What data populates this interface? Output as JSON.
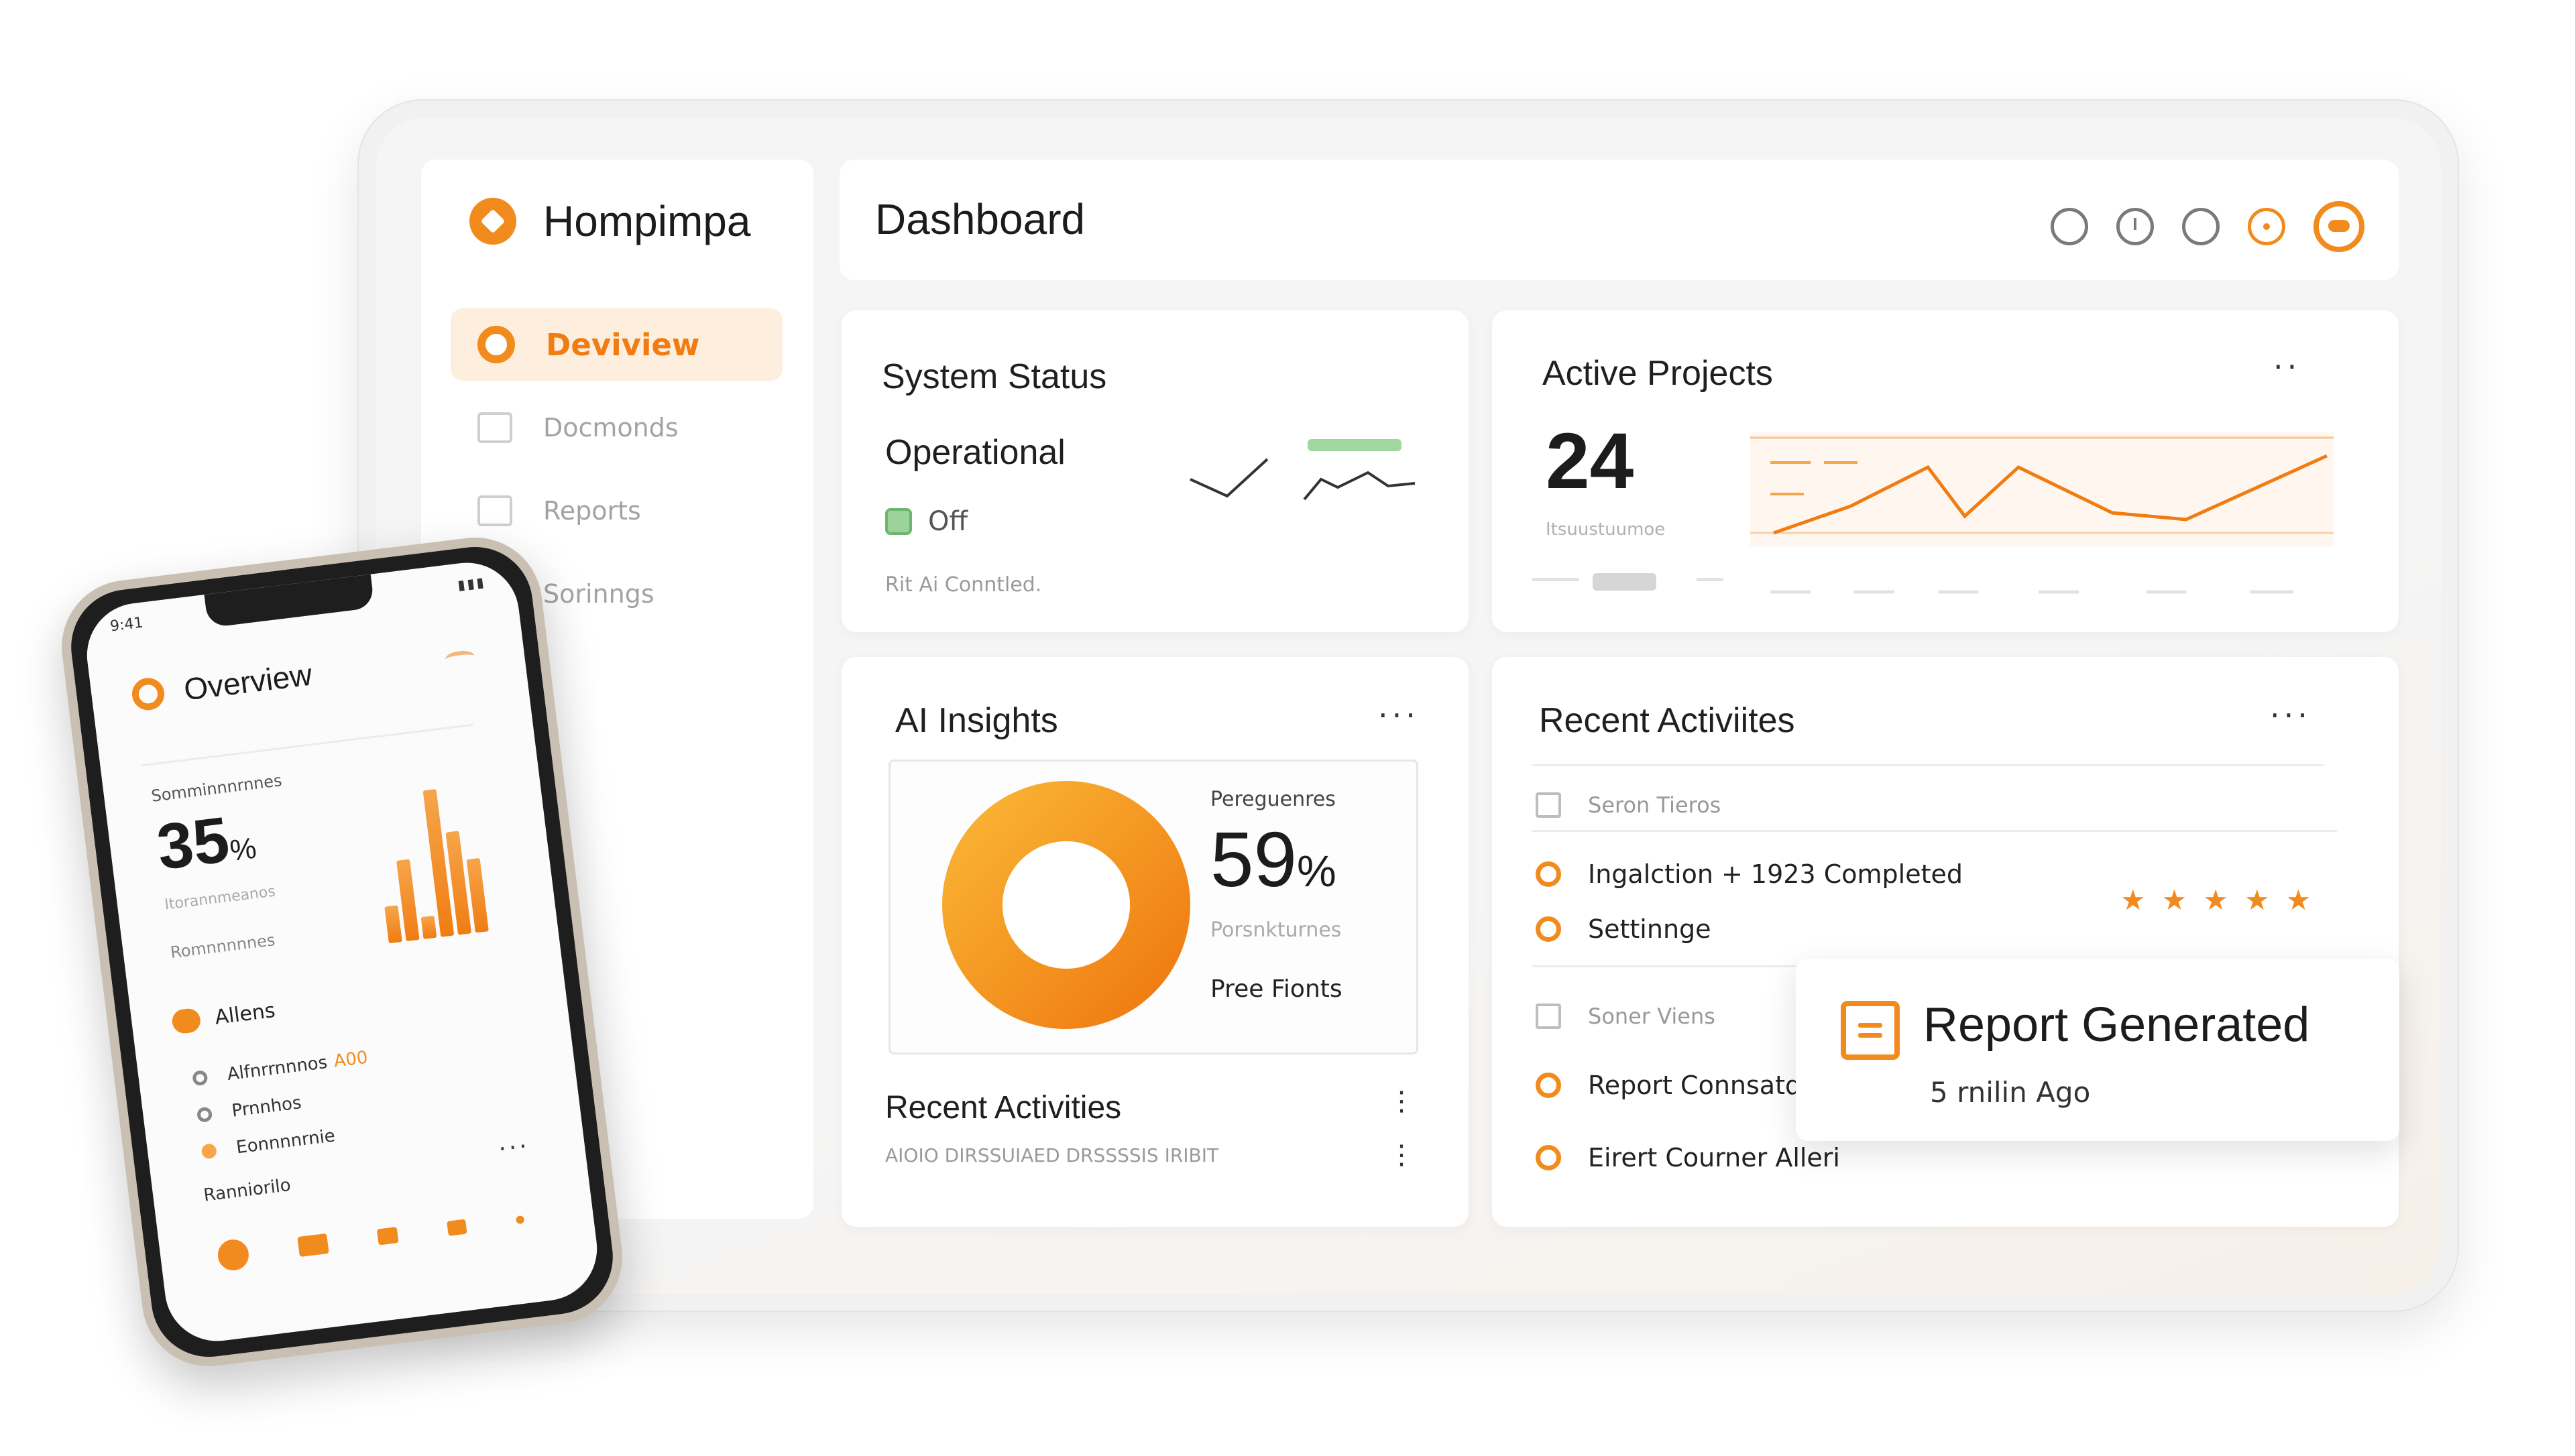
{
  "colors": {
    "accent": "#f28b1e",
    "accent_light": "#fdeede",
    "background": "#f5f5f5"
  },
  "sidebar": {
    "brand": "Hompimpa",
    "items": [
      {
        "label": "Deviview",
        "icon": "circle-icon",
        "active": true
      },
      {
        "label": "Docmonds",
        "icon": "document-icon",
        "active": false
      },
      {
        "label": "Reports",
        "icon": "report-icon",
        "active": false
      },
      {
        "label": "Sorinngs",
        "icon": "settings-icon",
        "active": false
      }
    ]
  },
  "header": {
    "title": "Dashboard",
    "icons": [
      "circle-icon",
      "clock-icon",
      "circle-icon",
      "notification-icon",
      "avatar-icon"
    ]
  },
  "system_status": {
    "title": "System Status",
    "status": "Operational",
    "toggle_label": "Off",
    "footer": "Rit Ai Conntled."
  },
  "active_projects": {
    "title": "Active Projects",
    "count": "24",
    "subtitle": "Itsuustuumoe",
    "menu": "··"
  },
  "ai_insights": {
    "title": "AI Insights",
    "menu": "···",
    "percent_label": "Pereguenres",
    "percent_value": "59",
    "percent_unit": "%",
    "percent_sub": "Porsnkturnes",
    "percent_footer": "Pree Fionts",
    "progress": 0.59,
    "recent_title": "Recent Activities",
    "recent_footer": "AIOIO DIRSSUIAED DRSSSSIS IRIBIT",
    "menu_vertical": "⋮"
  },
  "recent_activities": {
    "title": "Recent Activiites",
    "menu": "···",
    "items": [
      {
        "label": "Seron Tieros",
        "type": "header"
      },
      {
        "label": "Ingalction + 1923 Completed",
        "type": "bullet"
      },
      {
        "label": "Settinnge",
        "type": "bullet"
      },
      {
        "label": "Soner Viens",
        "type": "header"
      },
      {
        "label": "Report Connsatd",
        "type": "bullet"
      },
      {
        "label": "Eirert Courner Alleri",
        "type": "bullet"
      }
    ],
    "rating_stars": 5
  },
  "toast": {
    "title": "Report Generated",
    "time": "5 rnilin Ago",
    "icon": "document-icon"
  },
  "phone": {
    "time": "9:41",
    "signal": "▮▮▮",
    "title": "Overview",
    "stat_label": "Somminnnrnnes",
    "stat_value": "35",
    "stat_unit": "%",
    "stat_sub": "Itorannmeanos",
    "stat_footer": "Romnnnnnes",
    "bar_values": [
      0.25,
      0.55,
      0.15,
      1.0,
      0.7,
      0.5
    ],
    "alerts_label": "Allens",
    "items": [
      {
        "label": "Alfnrrnnnos",
        "tag": "A00"
      },
      {
        "label": "Prnnhos",
        "tag": ""
      },
      {
        "label": "Eonnnnrnie",
        "tag": ""
      }
    ],
    "footer": "Ranniorilo",
    "footer_menu": "···",
    "nav_icons": [
      "home-icon",
      "folder-icon",
      "chart-icon",
      "bell-icon",
      "dot-icon"
    ]
  }
}
